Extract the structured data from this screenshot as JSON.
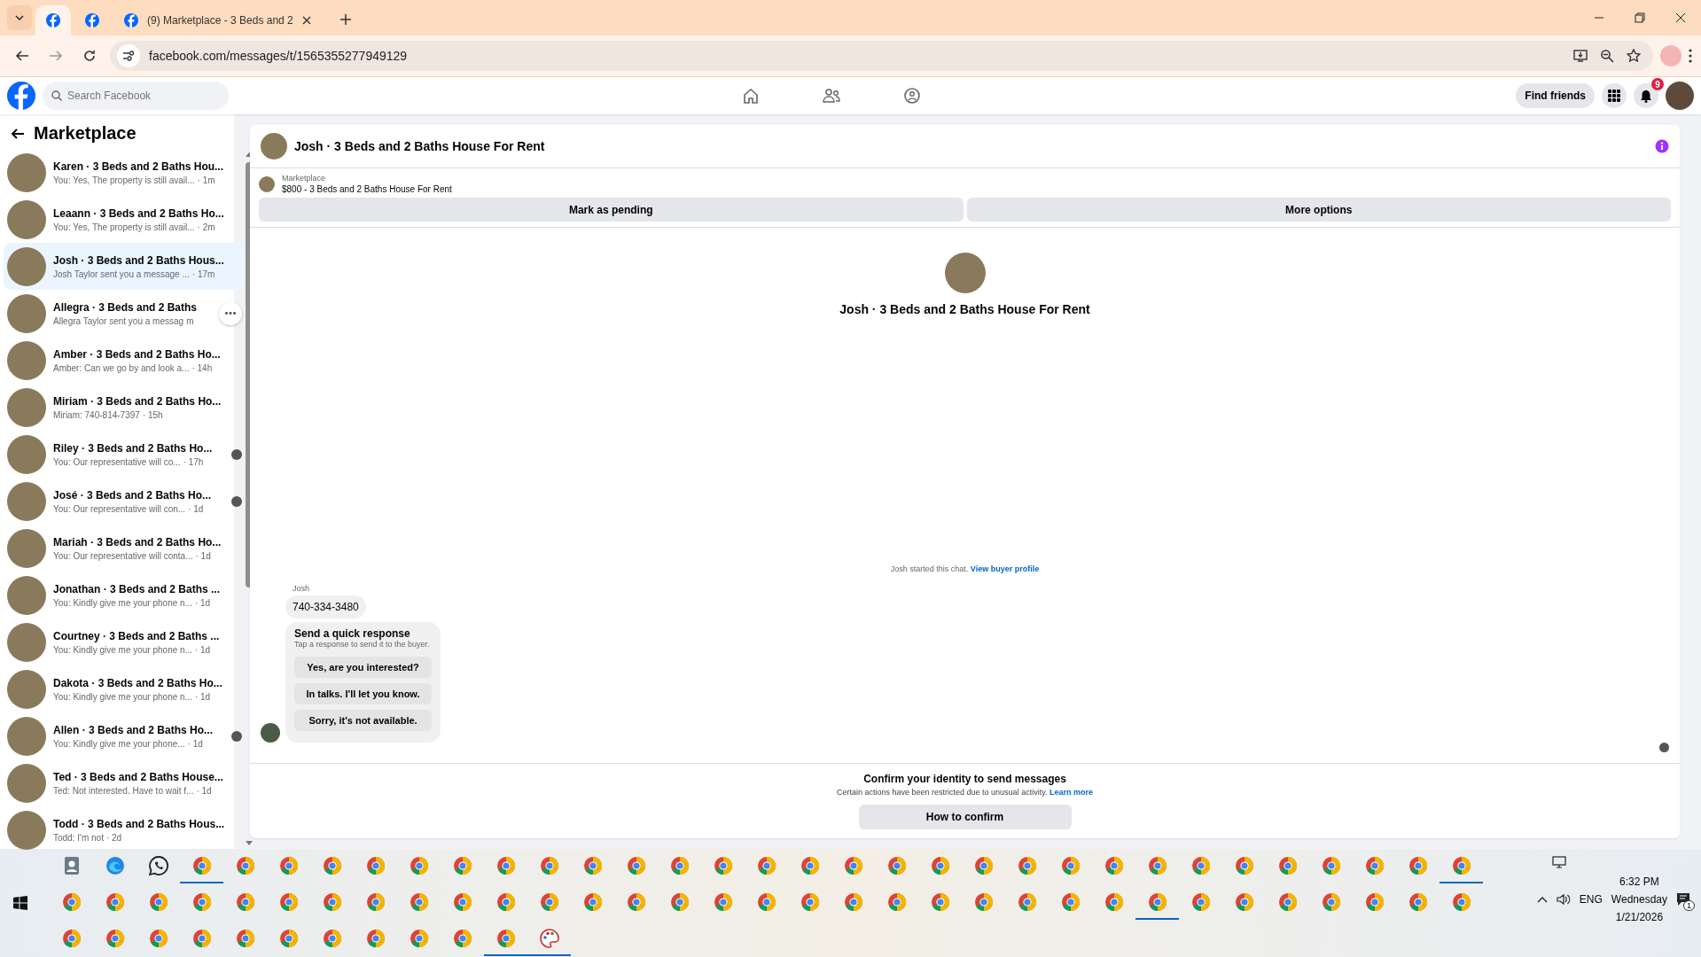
{
  "browser": {
    "tabs": [
      {
        "selected": true
      },
      {
        "selected": false
      },
      {
        "title": "(9) Marketplace - 3 Beds and 2",
        "selected": false
      }
    ],
    "url": "facebook.com/messages/t/1565355277949129"
  },
  "header": {
    "search": {
      "placeholder": "Search Facebook"
    },
    "find_friends": "Find friends",
    "notification_count": "9"
  },
  "sidebar": {
    "title": "Marketplace",
    "items": [
      {
        "title": "Karen · 3 Beds and 2 Baths Hou...",
        "preview": "You: Yes, The property is still avail...",
        "time": "· 1m",
        "selected": false,
        "seen": false,
        "menu": false
      },
      {
        "title": "Leaann · 3 Beds and 2 Baths Ho...",
        "preview": "You: Yes, The property is still avail...",
        "time": "· 2m",
        "selected": false,
        "seen": false,
        "menu": false
      },
      {
        "title": "Josh · 3 Beds and 2 Baths Hous...",
        "preview": "Josh Taylor sent you a message ...",
        "time": "· 17m",
        "selected": true,
        "seen": false,
        "menu": false
      },
      {
        "title": "Allegra · 3 Beds and 2 Baths",
        "preview": "Allegra Taylor sent you a messag",
        "time": "m",
        "selected": false,
        "seen": false,
        "menu": true
      },
      {
        "title": "Amber · 3 Beds and 2 Baths Ho...",
        "preview": "Amber: Can we go by and look a...",
        "time": "· 14h",
        "selected": false,
        "seen": false,
        "menu": false
      },
      {
        "title": "Miriam · 3 Beds and 2 Baths Ho...",
        "preview": "Miriam: 740-814-7397",
        "time": "· 15h",
        "selected": false,
        "seen": false,
        "menu": false
      },
      {
        "title": "Riley · 3 Beds and 2 Baths Ho...",
        "preview": "You: Our representative will co...",
        "time": "· 17h",
        "selected": false,
        "seen": true,
        "menu": false
      },
      {
        "title": "José · 3 Beds and 2 Baths Ho...",
        "preview": "You: Our representative will con...",
        "time": "· 1d",
        "selected": false,
        "seen": true,
        "menu": false
      },
      {
        "title": "Mariah · 3 Beds and 2 Baths Ho...",
        "preview": "You: Our representative will conta...",
        "time": "· 1d",
        "selected": false,
        "seen": false,
        "menu": false
      },
      {
        "title": "Jonathan · 3 Beds and 2 Baths ...",
        "preview": "You: Kindly give me your phone n...",
        "time": "· 1d",
        "selected": false,
        "seen": false,
        "menu": false
      },
      {
        "title": "Courtney · 3 Beds and 2 Baths ...",
        "preview": "You: Kindly give me your phone n...",
        "time": "· 1d",
        "selected": false,
        "seen": false,
        "menu": false
      },
      {
        "title": "Dakota · 3 Beds and 2 Baths Ho...",
        "preview": "You: Kindly give me your phone n...",
        "time": "· 1d",
        "selected": false,
        "seen": false,
        "menu": false
      },
      {
        "title": "Allen · 3 Beds and 2 Baths Ho...",
        "preview": "You: Kindly give me your phone...",
        "time": "· 1d",
        "selected": false,
        "seen": true,
        "menu": false
      },
      {
        "title": "Ted · 3 Beds and 2 Baths House...",
        "preview": "Ted: Not interested. Have to wait f...",
        "time": "· 1d",
        "selected": false,
        "seen": false,
        "menu": false
      },
      {
        "title": "Todd · 3 Beds and 2 Baths Hous...",
        "preview": "Todd: I'm not",
        "time": "· 2d",
        "selected": false,
        "seen": false,
        "menu": false
      }
    ]
  },
  "chat": {
    "title": "Josh · 3 Beds and 2 Baths House For Rent",
    "listing": {
      "label": "Marketplace",
      "text": "$800 - 3 Beds and 2 Baths House For Rent",
      "buttons": [
        "Mark as pending",
        "More options"
      ]
    },
    "intro_title": "Josh · 3 Beds and 2 Baths House For Rent",
    "started": {
      "text": "Josh started this chat.",
      "link": "View buyer profile"
    },
    "sender": "Josh",
    "message": "740-334-3480",
    "quick": {
      "title": "Send a quick response",
      "subtitle": "Tap a response to send it to the buyer.",
      "options": [
        "Yes, are you interested?",
        "In talks. I'll let you know.",
        "Sorry, it's not available."
      ]
    },
    "confirm": {
      "title": "Confirm your identity to send messages",
      "text": "Certain actions have been restricted due to unusual activity.",
      "link": "Learn more",
      "button": "How to confirm"
    }
  },
  "taskbar": {
    "rows": [
      [
        {
          "kind": "app",
          "running": false
        },
        {
          "kind": "edge",
          "running": false
        },
        {
          "kind": "whatsapp",
          "running": false
        },
        {
          "kind": "chrome",
          "running": true
        },
        {
          "kind": "chrome",
          "running": false
        },
        {
          "kind": "chrome",
          "running": false
        },
        {
          "kind": "chrome",
          "running": false
        },
        {
          "kind": "chrome",
          "running": false
        },
        {
          "kind": "chrome",
          "running": false
        },
        {
          "kind": "chrome",
          "running": false
        },
        {
          "kind": "chrome",
          "running": false
        },
        {
          "kind": "chrome",
          "running": false
        },
        {
          "kind": "chrome",
          "running": false
        },
        {
          "kind": "chrome",
          "running": false
        },
        {
          "kind": "chrome",
          "running": false
        },
        {
          "kind": "chrome",
          "running": false
        },
        {
          "kind": "chrome",
          "running": false
        },
        {
          "kind": "chrome",
          "running": false
        },
        {
          "kind": "chrome",
          "running": false
        },
        {
          "kind": "chrome",
          "running": false
        },
        {
          "kind": "chrome",
          "running": false
        },
        {
          "kind": "chrome",
          "running": false
        },
        {
          "kind": "chrome",
          "running": false
        },
        {
          "kind": "chrome",
          "running": false
        },
        {
          "kind": "chrome",
          "running": false
        },
        {
          "kind": "chrome",
          "running": false
        },
        {
          "kind": "chrome",
          "running": false
        },
        {
          "kind": "chrome",
          "running": false
        },
        {
          "kind": "chrome",
          "running": false
        },
        {
          "kind": "chrome",
          "running": false
        },
        {
          "kind": "chrome",
          "running": false
        },
        {
          "kind": "chrome",
          "running": false
        },
        {
          "kind": "chrome",
          "running": true
        }
      ],
      [
        {
          "kind": "chrome",
          "running": false
        },
        {
          "kind": "chrome",
          "running": false
        },
        {
          "kind": "chrome",
          "running": false
        },
        {
          "kind": "chrome",
          "running": false
        },
        {
          "kind": "chrome",
          "running": false
        },
        {
          "kind": "chrome",
          "running": false
        },
        {
          "kind": "chrome",
          "running": false
        },
        {
          "kind": "chrome",
          "running": false
        },
        {
          "kind": "chrome",
          "running": false
        },
        {
          "kind": "chrome",
          "running": false
        },
        {
          "kind": "chrome",
          "running": false
        },
        {
          "kind": "chrome",
          "running": false
        },
        {
          "kind": "chrome",
          "running": false
        },
        {
          "kind": "chrome",
          "running": false
        },
        {
          "kind": "chrome",
          "running": false
        },
        {
          "kind": "chrome",
          "running": false
        },
        {
          "kind": "chrome",
          "running": false
        },
        {
          "kind": "chrome",
          "running": false
        },
        {
          "kind": "chrome",
          "running": false
        },
        {
          "kind": "chrome",
          "running": false
        },
        {
          "kind": "chrome",
          "running": false
        },
        {
          "kind": "chrome",
          "running": false
        },
        {
          "kind": "chrome",
          "running": false
        },
        {
          "kind": "chrome",
          "running": false
        },
        {
          "kind": "chrome",
          "running": false
        },
        {
          "kind": "chrome",
          "running": true
        },
        {
          "kind": "chrome",
          "running": false
        },
        {
          "kind": "chrome",
          "running": false
        },
        {
          "kind": "chrome",
          "running": false
        },
        {
          "kind": "chrome",
          "running": false
        },
        {
          "kind": "chrome",
          "running": false
        },
        {
          "kind": "chrome",
          "running": false
        },
        {
          "kind": "chrome",
          "running": false
        }
      ],
      [
        {
          "kind": "chrome",
          "running": false
        },
        {
          "kind": "chrome",
          "running": false
        },
        {
          "kind": "chrome",
          "running": false
        },
        {
          "kind": "chrome",
          "running": false
        },
        {
          "kind": "chrome",
          "running": false
        },
        {
          "kind": "chrome",
          "running": false
        },
        {
          "kind": "chrome",
          "running": false
        },
        {
          "kind": "chrome",
          "running": false
        },
        {
          "kind": "chrome",
          "running": false
        },
        {
          "kind": "chrome",
          "running": false
        },
        {
          "kind": "chrome",
          "running": true
        },
        {
          "kind": "paint",
          "running": true
        }
      ]
    ],
    "language": "ENG",
    "time": "6:32 PM",
    "day": "Wednesday",
    "date": "1/21/2026",
    "notifications": "1"
  }
}
